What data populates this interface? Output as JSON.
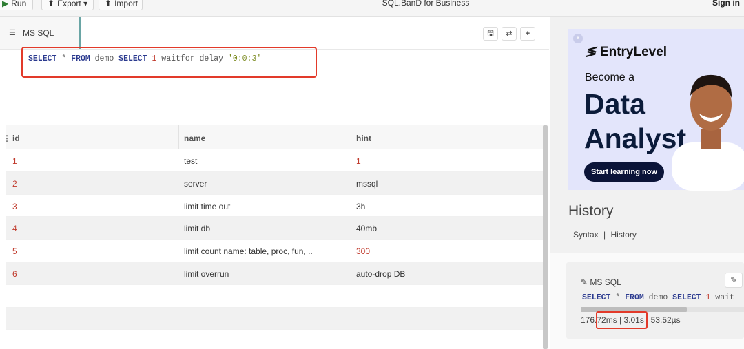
{
  "toolbar": {
    "run_label": "Run",
    "export_label": "Export",
    "import_label": "Import",
    "app_title": "SQL.BanD for Business",
    "signin_label": "Sign in"
  },
  "editor": {
    "tab_label": "MS SQL",
    "sql": {
      "kw_select": "SELECT",
      "star": " * ",
      "kw_from": "FROM",
      "table": " demo ",
      "kw_select2": "SELECT",
      "num": " 1",
      "rest": " waitfor delay ",
      "str": "'0:0:3'"
    }
  },
  "grid": {
    "columns": [
      "id",
      "name",
      "hint"
    ],
    "rows": [
      {
        "id": "1",
        "name": "test",
        "hint": "1",
        "hint_red": true
      },
      {
        "id": "2",
        "name": "server",
        "hint": "mssql",
        "hint_red": false
      },
      {
        "id": "3",
        "name": "limit time out",
        "hint": "3h",
        "hint_red": false
      },
      {
        "id": "4",
        "name": "limit db",
        "hint": "40mb",
        "hint_red": false
      },
      {
        "id": "5",
        "name": "limit count name: table, proc, fun, ..",
        "hint": "300",
        "hint_red": true
      },
      {
        "id": "6",
        "name": "limit overrun",
        "hint": "auto-drop DB",
        "hint_red": false
      }
    ]
  },
  "ad": {
    "brand": "EntryLevel",
    "line1": "Become a",
    "line2": "Data",
    "line3": "Analyst",
    "cta": "Start learning now"
  },
  "history": {
    "title": "History",
    "link_syntax": "Syntax",
    "link_sep": "|",
    "link_history": "History",
    "card": {
      "title": "MS SQL",
      "sql_kw_select": "SELECT",
      "sql_star": " * ",
      "sql_kw_from": "FROM",
      "sql_table": " demo ",
      "sql_kw_select2": "SELECT",
      "sql_num": " 1",
      "sql_rest": " wait",
      "time1": "176.72ms",
      "time2": "| 3.01s",
      "time3": "| 53.52µs"
    }
  }
}
